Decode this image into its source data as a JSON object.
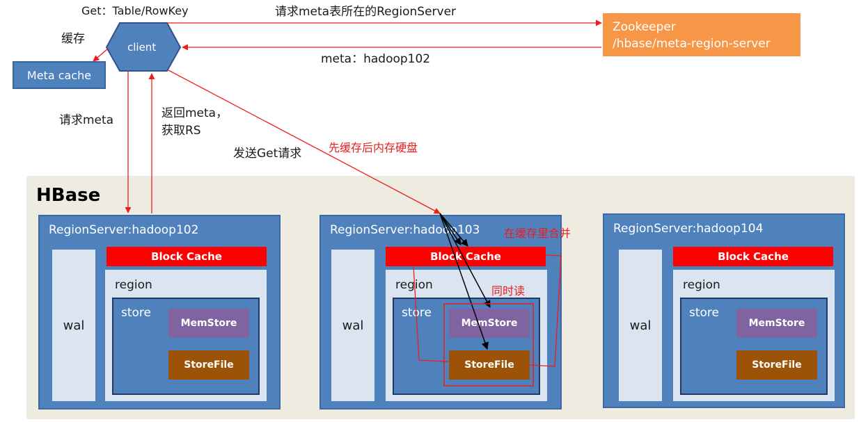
{
  "client": {
    "label": "client",
    "get_label": "Get：Table/RowKey",
    "cache_label": "缓存",
    "meta_cache": "Meta cache"
  },
  "zookeeper": {
    "line1": "Zookeeper",
    "line2": "/hbase/meta-region-server"
  },
  "edges": {
    "request_meta_location": "请求meta表所在的RegionServer",
    "meta_reply": "meta：hadoop102",
    "request_meta": "请求meta",
    "return_meta_line1": "返回meta，",
    "return_meta_line2": "获取RS",
    "send_get": "发送Get请求",
    "cache_then_mem_then_disk": "先缓存后内存硬盘",
    "merge_in_cache": "在缓存里合并",
    "read_together": "同时读"
  },
  "hbase": {
    "title": "HBase",
    "region_servers": [
      {
        "title": "RegionServer:hadoop102",
        "wal": "wal",
        "block_cache": "Block Cache",
        "region": "region",
        "store": "store",
        "memstore": "MemStore",
        "storefile": "StoreFile"
      },
      {
        "title": "RegionServer:hadoop103",
        "wal": "wal",
        "block_cache": "Block Cache",
        "region": "region",
        "store": "store",
        "memstore": "MemStore",
        "storefile": "StoreFile"
      },
      {
        "title": "RegionServer:hadoop104",
        "wal": "wal",
        "block_cache": "Block Cache",
        "region": "region",
        "store": "store",
        "memstore": "MemStore",
        "storefile": "StoreFile"
      }
    ]
  },
  "colors": {
    "blue": "#4f81bd",
    "light_blue": "#dbe5f1",
    "red": "#ff0000",
    "purple": "#8064a2",
    "brown": "#9c5207",
    "orange": "#f79646",
    "beige": "#eeece1"
  }
}
